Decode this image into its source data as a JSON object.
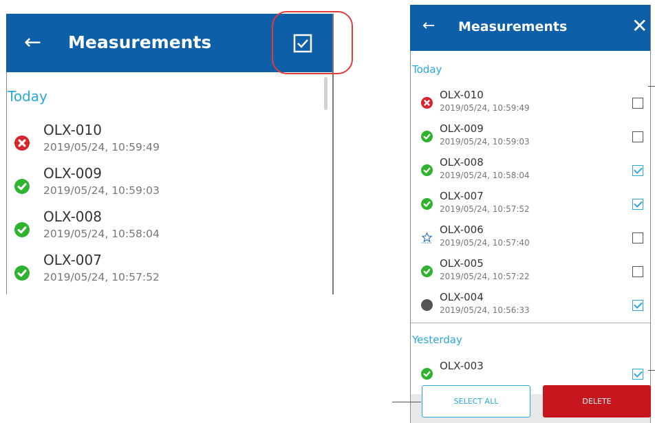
{
  "left_panel": {
    "header": {
      "back_glyph": "←",
      "title": "Measurements",
      "select_icon": "checkbox-select-icon"
    },
    "section_today": "Today",
    "items": [
      {
        "name": "OLX-010",
        "date": "2019/05/24, 10:59:49",
        "status": "fail"
      },
      {
        "name": "OLX-009",
        "date": "2019/05/24, 10:59:03",
        "status": "pass"
      },
      {
        "name": "OLX-008",
        "date": "2019/05/24, 10:58:04",
        "status": "pass"
      },
      {
        "name": "OLX-007",
        "date": "2019/05/24, 10:57:52",
        "status": "pass"
      }
    ]
  },
  "right_panel": {
    "header": {
      "back_glyph": "←",
      "title": "Measurements",
      "close_glyph": "✕"
    },
    "section_today": "Today",
    "section_yesterday": "Yesterday",
    "today_items": [
      {
        "name": "OLX-010",
        "date": "2019/05/24, 10:59:49",
        "status": "fail",
        "checked": false
      },
      {
        "name": "OLX-009",
        "date": "2019/05/24, 10:59:03",
        "status": "pass",
        "checked": false
      },
      {
        "name": "OLX-008",
        "date": "2019/05/24, 10:58:04",
        "status": "pass",
        "checked": true
      },
      {
        "name": "OLX-007",
        "date": "2019/05/24, 10:57:52",
        "status": "pass",
        "checked": true
      },
      {
        "name": "OLX-006",
        "date": "2019/05/24, 10:57:40",
        "status": "star",
        "checked": false
      },
      {
        "name": "OLX-005",
        "date": "2019/05/24, 10:57:22",
        "status": "pass",
        "checked": false
      },
      {
        "name": "OLX-004",
        "date": "2019/05/24, 10:56:33",
        "status": "none",
        "checked": true
      }
    ],
    "yesterday_items": [
      {
        "name": "OLX-003",
        "status": "pass",
        "checked": true
      }
    ],
    "select_all_label": "SELECT ALL",
    "delete_label": "DELETE"
  },
  "colors": {
    "header_blue": "#0d5fa8",
    "section_blue": "#29a8e0",
    "fail_red": "#d9232d",
    "pass_green": "#2fb32f",
    "delete_red": "#c8161d",
    "highlight_red": "#e43a3a"
  }
}
